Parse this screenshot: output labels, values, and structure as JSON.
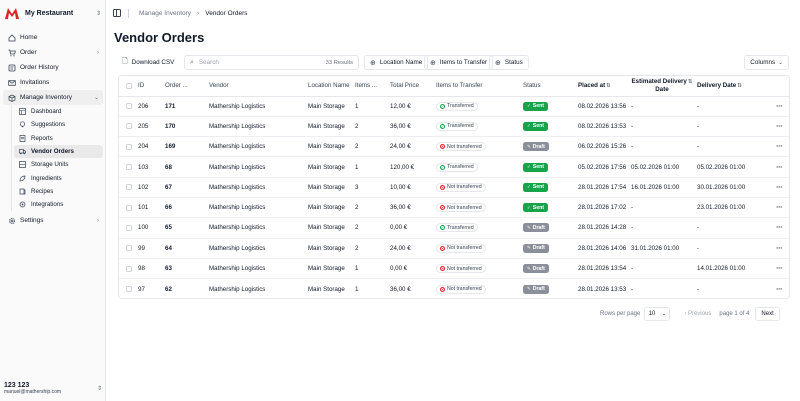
{
  "brand": {
    "name": "My Restaurant",
    "logo_color": "#dc2626"
  },
  "nav": {
    "items": [
      {
        "label": "Home",
        "icon": "home-icon"
      },
      {
        "label": "Order",
        "icon": "cart-icon",
        "has_chevron": true
      },
      {
        "label": "Order History",
        "icon": "history-icon"
      },
      {
        "label": "Invitations",
        "icon": "mail-icon"
      },
      {
        "label": "Manage Inventory",
        "icon": "box-icon",
        "expanded": true
      }
    ],
    "sub_items": [
      {
        "label": "Dashboard",
        "icon": "dashboard-icon"
      },
      {
        "label": "Suggestions",
        "icon": "bulb-icon"
      },
      {
        "label": "Reports",
        "icon": "reports-icon"
      },
      {
        "label": "Vendor Orders",
        "icon": "truck-icon",
        "active": true
      },
      {
        "label": "Storage Units",
        "icon": "storage-icon"
      },
      {
        "label": "Ingredients",
        "icon": "ingredients-icon"
      },
      {
        "label": "Recipes",
        "icon": "recipes-icon"
      },
      {
        "label": "Integrations",
        "icon": "integrations-icon"
      }
    ],
    "settings": "Settings"
  },
  "user": {
    "name": "123 123",
    "email": "manuel@mathership.com"
  },
  "breadcrumb": {
    "parent": "Manage Inventory",
    "current": "Vendor Orders"
  },
  "page": {
    "title": "Vendor Orders"
  },
  "toolbar": {
    "download_label": "Download CSV",
    "search_placeholder": "Search",
    "results": "33 Results",
    "filter_location": "Location Name",
    "filter_transfer": "Items to Transfer",
    "filter_status": "Status",
    "columns_label": "Columns"
  },
  "table": {
    "headers": {
      "id": "ID",
      "order": "Order ...",
      "vendor": "Vendor",
      "location": "Location Name",
      "items": "Items ...",
      "total": "Total Price",
      "transfer": "Items to Transfer",
      "status": "Status",
      "placed": "Placed at",
      "est_delivery_1": "Estimated Delivery",
      "est_delivery_2": "Date",
      "delivery": "Delivery Date"
    },
    "rows": [
      {
        "id": "206",
        "order": "171",
        "vendor": "Mathership Logistics",
        "location": "Main Storage",
        "items": "1",
        "total": "12,00 €",
        "transfer": "Transferred",
        "transferred": true,
        "status": "Sent",
        "placed": "08.02.2026 13:56",
        "est": "-",
        "delivery": "-"
      },
      {
        "id": "205",
        "order": "170",
        "vendor": "Mathership Logistics",
        "location": "Main Storage",
        "items": "2",
        "total": "36,00 €",
        "transfer": "Transferred",
        "transferred": true,
        "status": "Sent",
        "placed": "08.02.2026 13:53",
        "est": "-",
        "delivery": "-"
      },
      {
        "id": "204",
        "order": "169",
        "vendor": "Mathership Logistics",
        "location": "Main Storage",
        "items": "2",
        "total": "24,00 €",
        "transfer": "Not transferred",
        "transferred": false,
        "status": "Draft",
        "placed": "06.02.2026 15:26",
        "est": "-",
        "delivery": "-"
      },
      {
        "id": "103",
        "order": "68",
        "vendor": "Mathership Logistics",
        "location": "Main Storage",
        "items": "1",
        "total": "120,00 €",
        "transfer": "Transferred",
        "transferred": true,
        "status": "Sent",
        "placed": "05.02.2026 17:56",
        "est": "05.02.2026 01:00",
        "delivery": "05.02.2026 01:00"
      },
      {
        "id": "102",
        "order": "67",
        "vendor": "Mathership Logistics",
        "location": "Main Storage",
        "items": "3",
        "total": "10,00 €",
        "transfer": "Not transferred",
        "transferred": false,
        "status": "Sent",
        "placed": "28.01.2026 17:54",
        "est": "16.01.2026 01:00",
        "delivery": "30.01.2026 01:00"
      },
      {
        "id": "101",
        "order": "66",
        "vendor": "Mathership Logistics",
        "location": "Main Storage",
        "items": "2",
        "total": "36,00 €",
        "transfer": "Not transferred",
        "transferred": false,
        "status": "Sent",
        "placed": "28.01.2026 17:02",
        "est": "-",
        "delivery": "23.01.2026 01:00"
      },
      {
        "id": "100",
        "order": "65",
        "vendor": "Mathership Logistics",
        "location": "Main Storage",
        "items": "2",
        "total": "0,00 €",
        "transfer": "Transferred",
        "transferred": true,
        "status": "Draft",
        "placed": "28.01.2026 14:28",
        "est": "-",
        "delivery": "-"
      },
      {
        "id": "99",
        "order": "64",
        "vendor": "Mathership Logistics",
        "location": "Main Storage",
        "items": "2",
        "total": "24,00 €",
        "transfer": "Not transferred",
        "transferred": false,
        "status": "Draft",
        "placed": "28.01.2026 14:06",
        "est": "31.01.2026 01:00",
        "delivery": "-"
      },
      {
        "id": "98",
        "order": "63",
        "vendor": "Mathership Logistics",
        "location": "Main Storage",
        "items": "1",
        "total": "0,00 €",
        "transfer": "Not transferred",
        "transferred": false,
        "status": "Draft",
        "placed": "28.01.2026 13:54",
        "est": "-",
        "delivery": "14.01.2026 01:00"
      },
      {
        "id": "97",
        "order": "62",
        "vendor": "Mathership Logistics",
        "location": "Main Storage",
        "items": "1",
        "total": "36,00 €",
        "transfer": "Not transferred",
        "transferred": false,
        "status": "Draft",
        "placed": "28.01.2026 13:53",
        "est": "-",
        "delivery": "-"
      }
    ]
  },
  "pagination": {
    "rows_label": "Rows per page",
    "rows_value": "10",
    "prev": "Previous",
    "page_info": "page 1 of 4",
    "next": "Next"
  },
  "colors": {
    "sent": "#16a34a",
    "draft": "#8a8f99",
    "accent": "#dc2626"
  }
}
